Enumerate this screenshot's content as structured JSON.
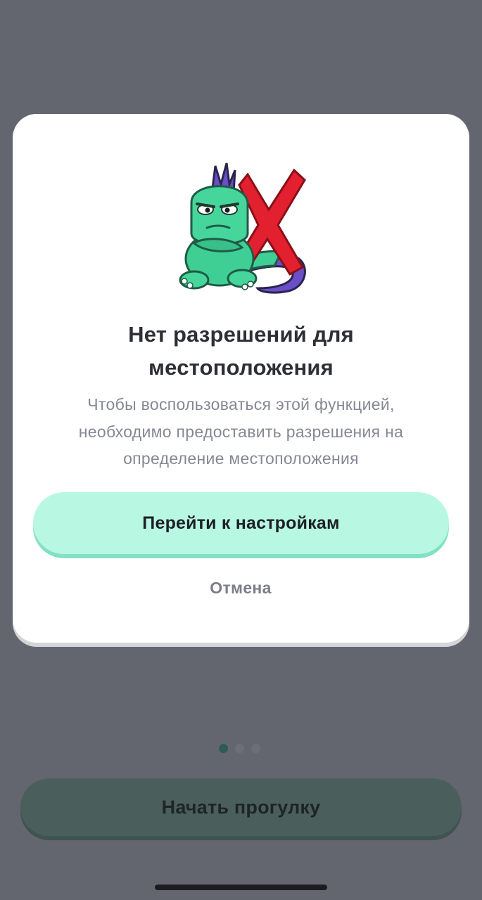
{
  "dialog": {
    "title_lines": [
      "Нет разрешений для",
      "местоположения"
    ],
    "message_lines": [
      "Чтобы воспользоваться этой функцией,",
      "необходимо предоставить разрешения на",
      "определение местоположения"
    ],
    "primary_button": "Перейти к настройкам",
    "cancel_button": "Отмена",
    "illustration": "dinosaur-with-red-x-icon"
  },
  "pager": {
    "current_page": 1,
    "total_pages": 3
  },
  "bottom": {
    "start_button": "Начать прогулку"
  },
  "colors": {
    "overlay": "#64666f",
    "dialog_background": "#ffffff",
    "primary_button": "#b8f8e3",
    "primary_button_shadow": "#83e1c3",
    "dinosaur_green": "#3fcf95",
    "cross_red": "#e3202f",
    "active_dot": "#2f5a56",
    "start_button_dimmed": "#4a5f5c"
  }
}
